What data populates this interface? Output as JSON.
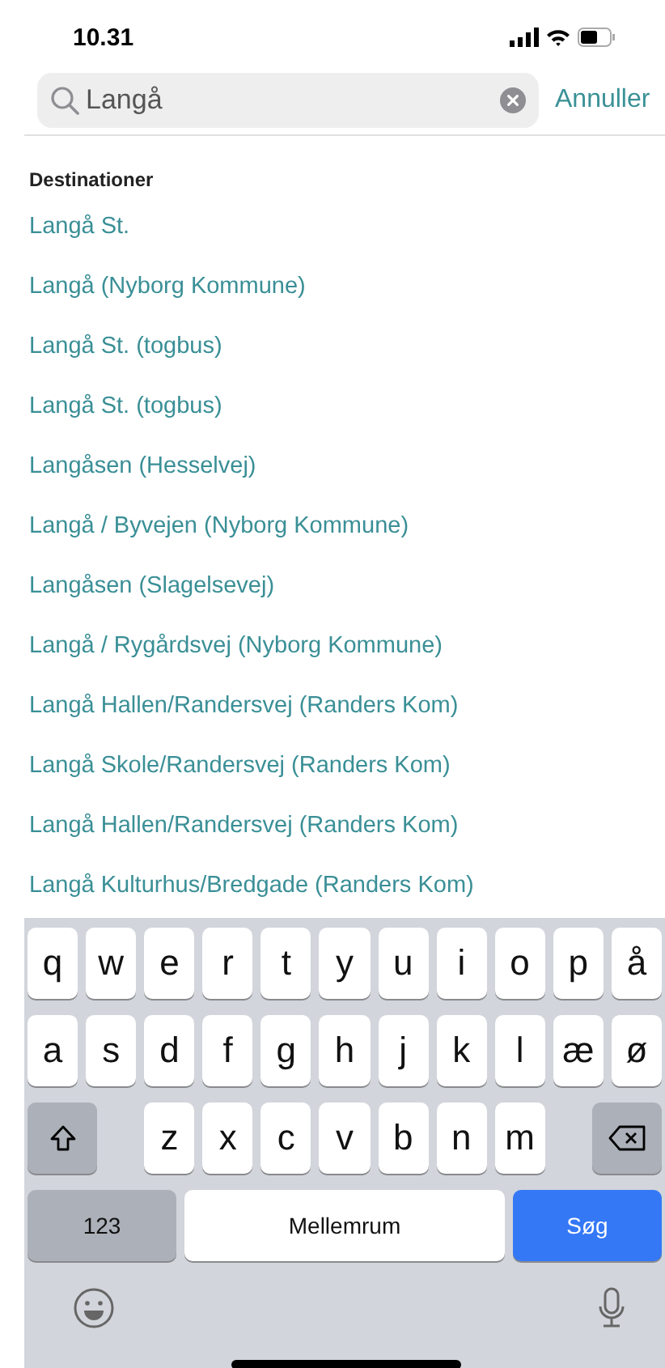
{
  "status_bar": {
    "time": "10.31"
  },
  "search": {
    "value": "Langå"
  },
  "cancel_button": "Annuller",
  "section_title": "Destinationer",
  "results": [
    "Langå St.",
    "Langå (Nyborg Kommune)",
    "Langå St. (togbus)",
    "Langå St. (togbus)",
    "Langåsen (Hesselvej)",
    "Langå / Byvejen (Nyborg Kommune)",
    "Langåsen (Slagelsevej)",
    "Langå / Rygårdsvej (Nyborg Kommune)",
    "Langå Hallen/Randersvej (Randers Kom)",
    "Langå Skole/Randersvej (Randers Kom)",
    "Langå Hallen/Randersvej (Randers Kom)",
    "Langå Kulturhus/Bredgade (Randers Kom)"
  ],
  "keyboard": {
    "rows": [
      [
        "q",
        "w",
        "e",
        "r",
        "t",
        "y",
        "u",
        "i",
        "o",
        "p",
        "å"
      ],
      [
        "a",
        "s",
        "d",
        "f",
        "g",
        "h",
        "j",
        "k",
        "l",
        "æ",
        "ø"
      ],
      [
        "",
        "",
        "z",
        "x",
        "c",
        "v",
        "b",
        "n",
        "m"
      ]
    ],
    "numbers_key": "123",
    "space_key": "Mellemrum",
    "return_key": "Søg"
  }
}
